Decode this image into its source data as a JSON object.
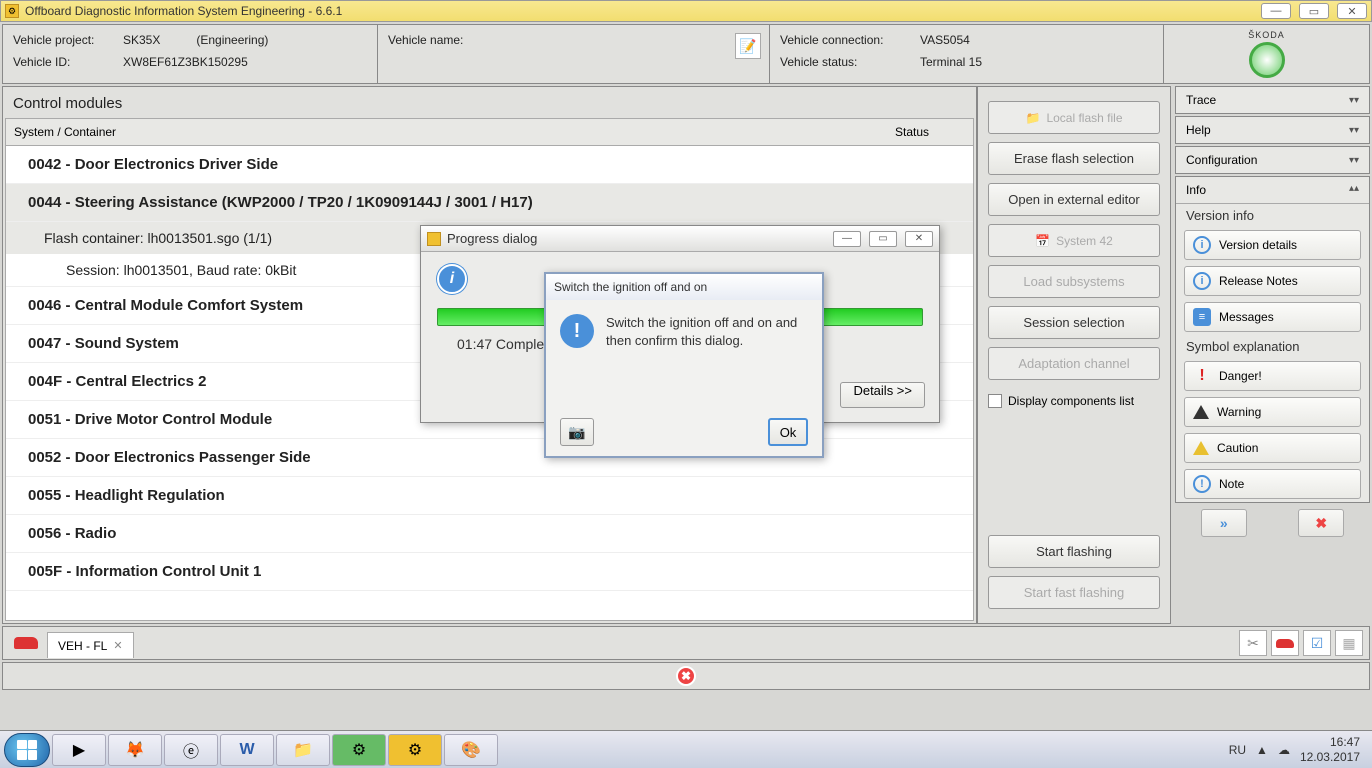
{
  "titlebar": {
    "title": "Offboard Diagnostic Information System Engineering - 6.6.1"
  },
  "header": {
    "vehicleProjectLabel": "Vehicle project:",
    "vehicleProject": "SK35X",
    "mode": "(Engineering)",
    "vehicleIdLabel": "Vehicle ID:",
    "vehicleId": "XW8EF61Z3BK150295",
    "vehicleNameLabel": "Vehicle name:",
    "vehicleConnectionLabel": "Vehicle connection:",
    "vehicleConnection": "VAS5054",
    "vehicleStatusLabel": "Vehicle status:",
    "vehicleStatus": "Terminal 15",
    "brand": "ŠKODA"
  },
  "cm": {
    "title": "Control modules",
    "col1": "System / Container",
    "col2": "Status",
    "items": [
      {
        "label": "0042 - Door Electronics Driver Side"
      },
      {
        "label": "0044 - Steering Assistance  (KWP2000 / TP20 / 1K0909144J / 3001 / H17)"
      },
      {
        "label": "0046 - Central Module Comfort System"
      },
      {
        "label": "0047 - Sound System"
      },
      {
        "label": "004F - Central Electrics 2"
      },
      {
        "label": "0051 - Drive Motor Control Module"
      },
      {
        "label": "0052 - Door Electronics Passenger Side"
      },
      {
        "label": "0055 - Headlight Regulation"
      },
      {
        "label": "0056 - Radio"
      },
      {
        "label": "005F - Information Control Unit 1"
      }
    ],
    "flashContainer": "Flash container: lh0013501.sgo (1/1)",
    "session": "Session: lh0013501, Baud rate: 0kBit"
  },
  "buttons": {
    "localFlash": "Local flash file",
    "eraseFlash": "Erase flash selection",
    "openExternal": "Open in external editor",
    "system42": "System 42",
    "loadSub": "Load subsystems",
    "sessionSel": "Session selection",
    "adaptation": "Adaptation channel",
    "displayComp": "Display components list",
    "startFlash": "Start flashing",
    "startFast": "Start fast flashing"
  },
  "accordions": {
    "trace": "Trace",
    "help": "Help",
    "config": "Configuration"
  },
  "info": {
    "header": "Info",
    "versionInfo": "Version info",
    "versionDetails": "Version details",
    "releaseNotes": "Release Notes",
    "messages": "Messages",
    "symbolExp": "Symbol explanation",
    "danger": "Danger!",
    "warning": "Warning",
    "caution": "Caution",
    "note": "Note"
  },
  "tabs": {
    "vehfl": "VEH - FL"
  },
  "progress": {
    "title": "Progress dialog",
    "text": "01:47  Complet",
    "details": "Details >>"
  },
  "confirm": {
    "title": "Switch the ignition off and on",
    "text": "Switch the ignition off and on and then confirm this dialog.",
    "ok": "Ok"
  },
  "tray": {
    "lang": "RU",
    "time": "16:47",
    "date": "12.03.2017"
  }
}
